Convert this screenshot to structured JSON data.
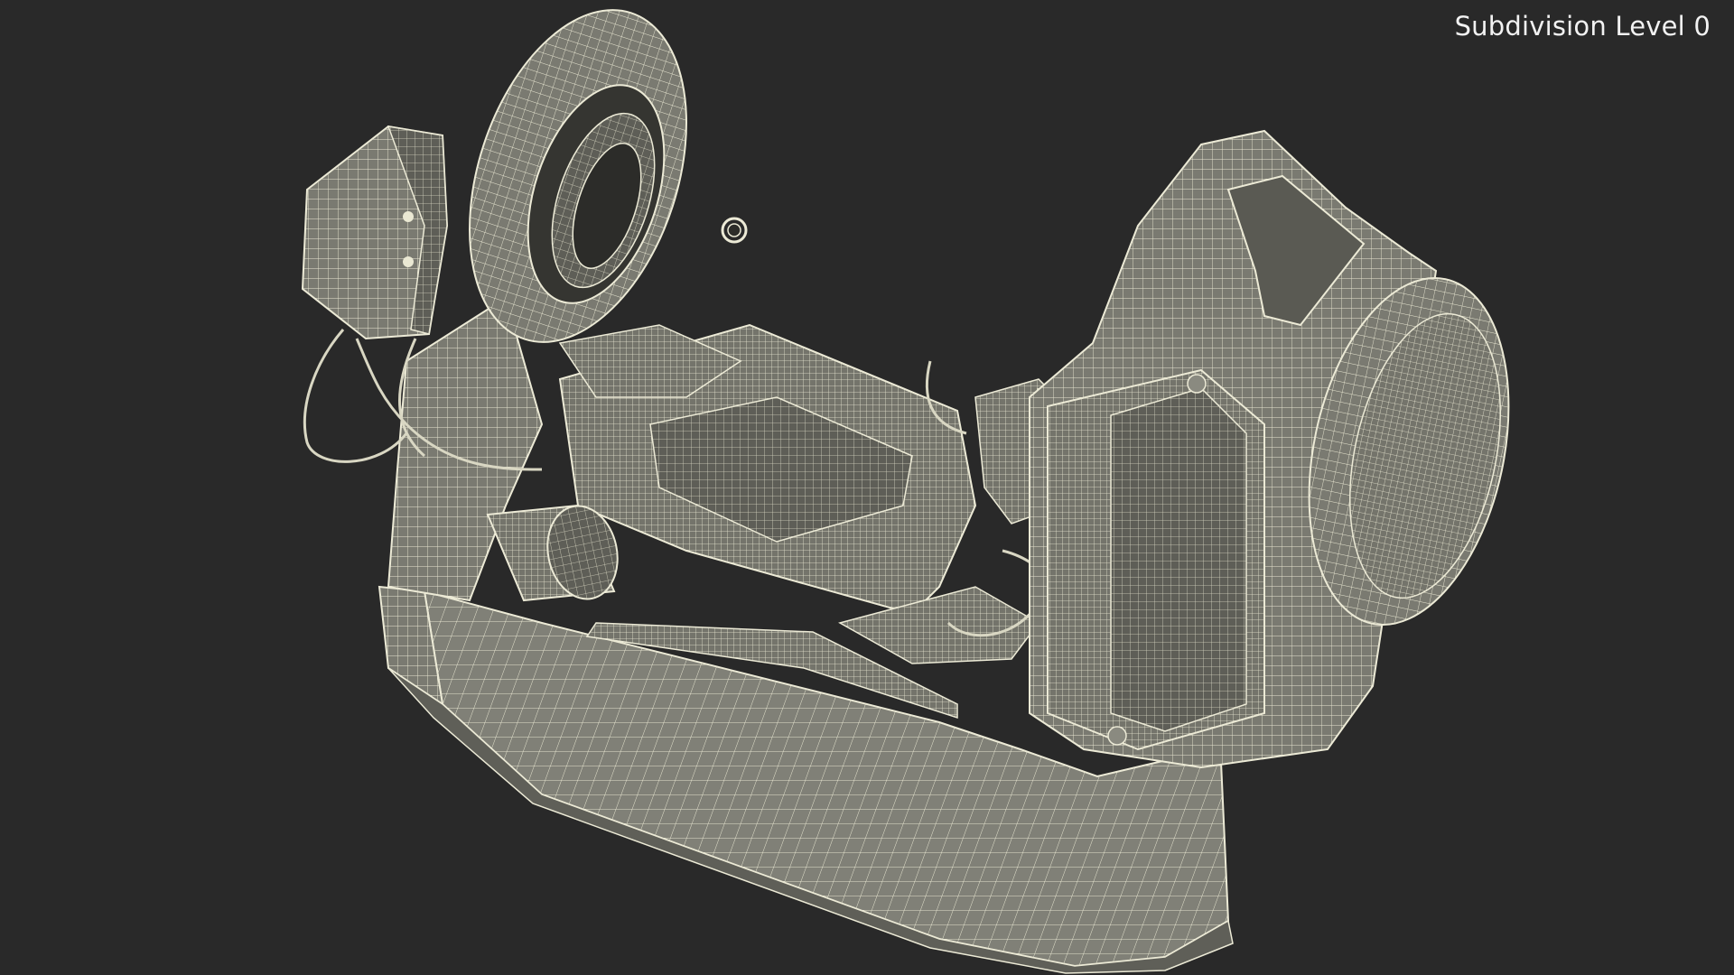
{
  "viewport": {
    "overlay_label": "Subdivision Level 0",
    "background_color": "#292929",
    "model_surface_color": "#7b7b72",
    "wire_color": "#ecead6"
  }
}
